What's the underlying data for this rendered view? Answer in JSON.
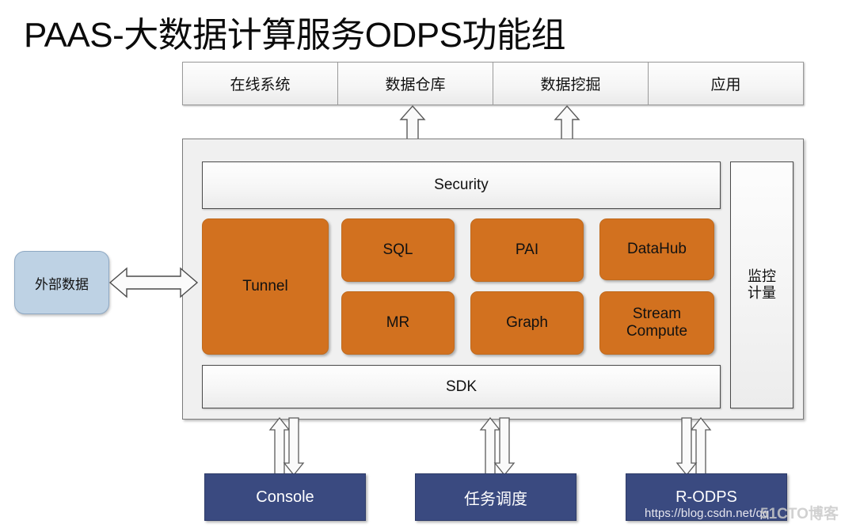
{
  "title": "PAAS-大数据计算服务ODPS功能组",
  "top_row": {
    "cells": [
      {
        "label": "在线系统"
      },
      {
        "label": "数据仓库"
      },
      {
        "label": "数据挖掘"
      },
      {
        "label": "应用"
      }
    ]
  },
  "container": {
    "security": {
      "label": "Security"
    },
    "sdk": {
      "label": "SDK"
    },
    "monitor": {
      "label": "监控计量",
      "line1": "监控",
      "line2": "计量"
    },
    "modules": [
      {
        "id": "tunnel",
        "label": "Tunnel"
      },
      {
        "id": "sql",
        "label": "SQL"
      },
      {
        "id": "pai",
        "label": "PAI"
      },
      {
        "id": "datahub",
        "label": "DataHub"
      },
      {
        "id": "mr",
        "label": "MR"
      },
      {
        "id": "graph",
        "label": "Graph"
      },
      {
        "id": "stream",
        "label": "Stream Compute"
      }
    ]
  },
  "external_data": {
    "label": "外部数据"
  },
  "bottom_tools": [
    {
      "id": "console",
      "label": "Console"
    },
    {
      "id": "scheduler",
      "label": "任务调度"
    },
    {
      "id": "rodps",
      "label": "R-ODPS"
    }
  ],
  "watermark": {
    "url": "https://blog.csdn.net/qq",
    "logo": "51CTO博客"
  },
  "colors": {
    "module_orange": "#d2711f",
    "tool_navy": "#3a4a80",
    "external_blue": "#bed2e4",
    "panel_gray": "#f0f0f0",
    "border_dark": "#4a4a4a"
  }
}
